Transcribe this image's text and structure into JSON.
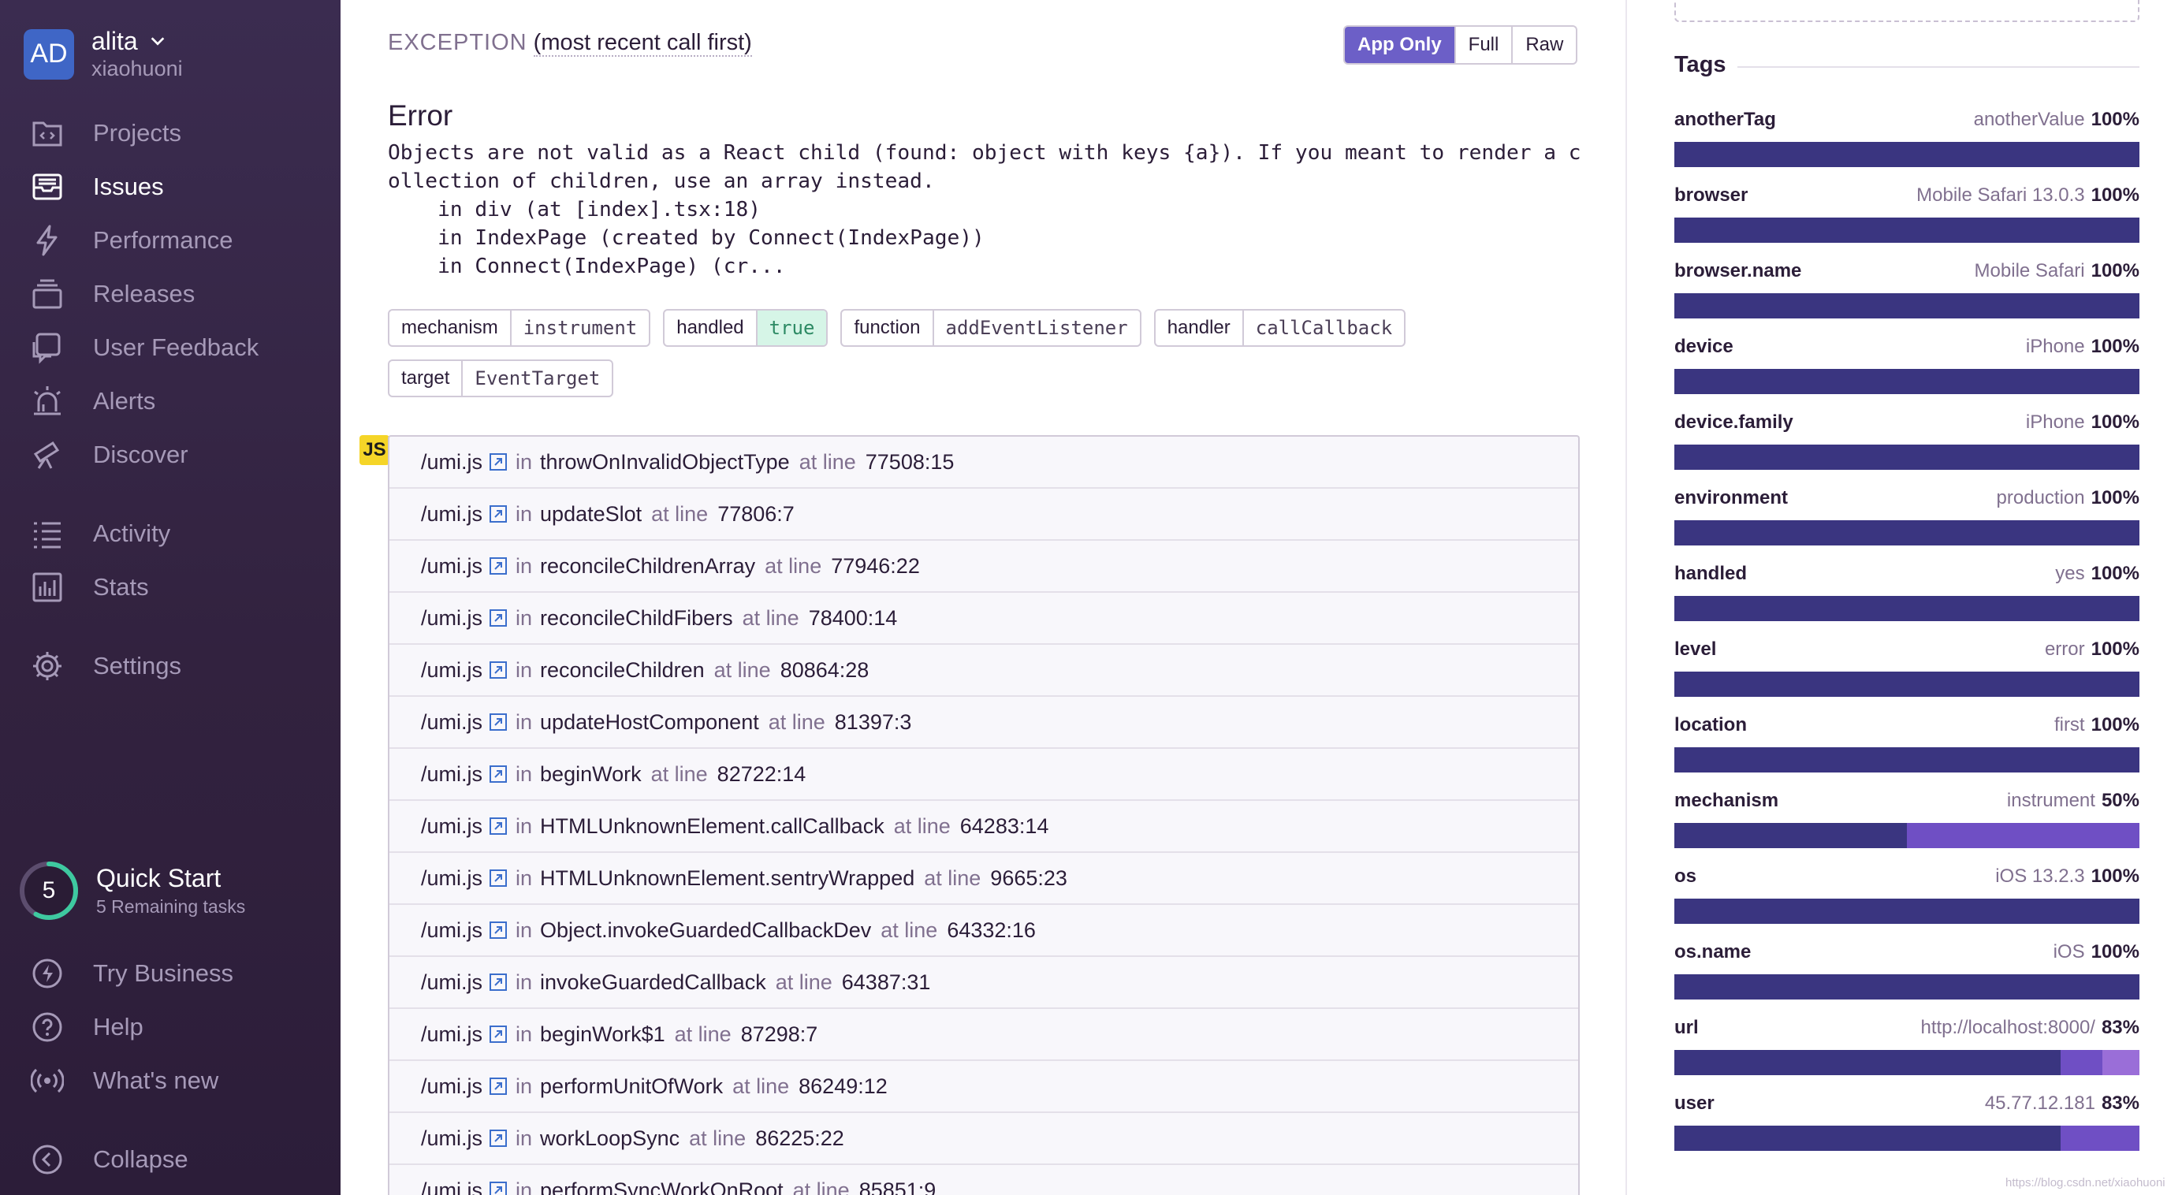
{
  "colors": {
    "sidebar_bg": "#32223f",
    "accent": "#6c5fc7",
    "bar_primary": "#3a3580",
    "bar_secondary": "#6f4fc4",
    "bar_tertiary": "#9a6ed8"
  },
  "org": {
    "avatar_initials": "AD",
    "name": "alita",
    "user": "xiaohuoni"
  },
  "nav": {
    "projects": "Projects",
    "issues": "Issues",
    "performance": "Performance",
    "releases": "Releases",
    "user_feedback": "User Feedback",
    "alerts": "Alerts",
    "discover": "Discover",
    "activity": "Activity",
    "stats": "Stats",
    "settings": "Settings",
    "try_business": "Try Business",
    "help": "Help",
    "whats_new": "What's new",
    "collapse": "Collapse"
  },
  "quick_start": {
    "count": "5",
    "title": "Quick Start",
    "subtitle": "5 Remaining tasks",
    "progress": 0.58
  },
  "exception": {
    "label": "EXCEPTION",
    "order": "(most recent call first)",
    "buttons": {
      "app_only": "App Only",
      "full": "Full",
      "raw": "Raw"
    },
    "error_title": "Error",
    "error_message": "Objects are not valid as a React child (found: object with keys {a}). If you meant to render a c\nollection of children, use an array instead.\n    in div (at [index].tsx:18)\n    in IndexPage (created by Connect(IndexPage))\n    in Connect(IndexPage) (cr..."
  },
  "mechanism_chips": [
    {
      "key": "mechanism",
      "value": "instrument",
      "highlight": false
    },
    {
      "key": "handled",
      "value": "true",
      "highlight": true
    },
    {
      "key": "function",
      "value": "addEventListener",
      "highlight": false
    },
    {
      "key": "handler",
      "value": "callCallback",
      "highlight": false
    },
    {
      "key": "target",
      "value": "EventTarget",
      "highlight": false
    }
  ],
  "platform_badge": "JS",
  "frame_words": {
    "in": "in",
    "at_line": "at line"
  },
  "frames": [
    {
      "file": "/umi.js",
      "function": "throwOnInvalidObjectType",
      "line": "77508:15"
    },
    {
      "file": "/umi.js",
      "function": "updateSlot",
      "line": "77806:7"
    },
    {
      "file": "/umi.js",
      "function": "reconcileChildrenArray",
      "line": "77946:22"
    },
    {
      "file": "/umi.js",
      "function": "reconcileChildFibers",
      "line": "78400:14"
    },
    {
      "file": "/umi.js",
      "function": "reconcileChildren",
      "line": "80864:28"
    },
    {
      "file": "/umi.js",
      "function": "updateHostComponent",
      "line": "81397:3"
    },
    {
      "file": "/umi.js",
      "function": "beginWork",
      "line": "82722:14"
    },
    {
      "file": "/umi.js",
      "function": "HTMLUnknownElement.callCallback",
      "line": "64283:14"
    },
    {
      "file": "/umi.js",
      "function": "HTMLUnknownElement.sentryWrapped",
      "line": "9665:23"
    },
    {
      "file": "/umi.js",
      "function": "Object.invokeGuardedCallbackDev",
      "line": "64332:16"
    },
    {
      "file": "/umi.js",
      "function": "invokeGuardedCallback",
      "line": "64387:31"
    },
    {
      "file": "/umi.js",
      "function": "beginWork$1",
      "line": "87298:7"
    },
    {
      "file": "/umi.js",
      "function": "performUnitOfWork",
      "line": "86249:12"
    },
    {
      "file": "/umi.js",
      "function": "workLoopSync",
      "line": "86225:22"
    },
    {
      "file": "/umi.js",
      "function": "performSyncWorkOnRoot",
      "line": "85851:9"
    }
  ],
  "tags": {
    "title": "Tags",
    "items": [
      {
        "key": "anotherTag",
        "value": "anotherValue",
        "percent": "100%",
        "segments": [
          1.0
        ]
      },
      {
        "key": "browser",
        "value": "Mobile Safari 13.0.3",
        "percent": "100%",
        "segments": [
          1.0
        ]
      },
      {
        "key": "browser.name",
        "value": "Mobile Safari",
        "percent": "100%",
        "segments": [
          1.0
        ]
      },
      {
        "key": "device",
        "value": "iPhone",
        "percent": "100%",
        "segments": [
          1.0
        ]
      },
      {
        "key": "device.family",
        "value": "iPhone",
        "percent": "100%",
        "segments": [
          1.0
        ]
      },
      {
        "key": "environment",
        "value": "production",
        "percent": "100%",
        "segments": [
          1.0
        ]
      },
      {
        "key": "handled",
        "value": "yes",
        "percent": "100%",
        "segments": [
          1.0
        ]
      },
      {
        "key": "level",
        "value": "error",
        "percent": "100%",
        "segments": [
          1.0
        ]
      },
      {
        "key": "location",
        "value": "first",
        "percent": "100%",
        "segments": [
          1.0
        ]
      },
      {
        "key": "mechanism",
        "value": "instrument",
        "percent": "50%",
        "segments": [
          0.5,
          0.5
        ]
      },
      {
        "key": "os",
        "value": "iOS 13.2.3",
        "percent": "100%",
        "segments": [
          1.0
        ]
      },
      {
        "key": "os.name",
        "value": "iOS",
        "percent": "100%",
        "segments": [
          1.0
        ]
      },
      {
        "key": "url",
        "value": "http://localhost:8000/",
        "percent": "83%",
        "segments": [
          0.83,
          0.09,
          0.08
        ]
      },
      {
        "key": "user",
        "value": "45.77.12.181",
        "percent": "83%",
        "segments": [
          0.83,
          0.17
        ]
      }
    ]
  },
  "watermark": "https://blog.csdn.net/xiaohuoni"
}
